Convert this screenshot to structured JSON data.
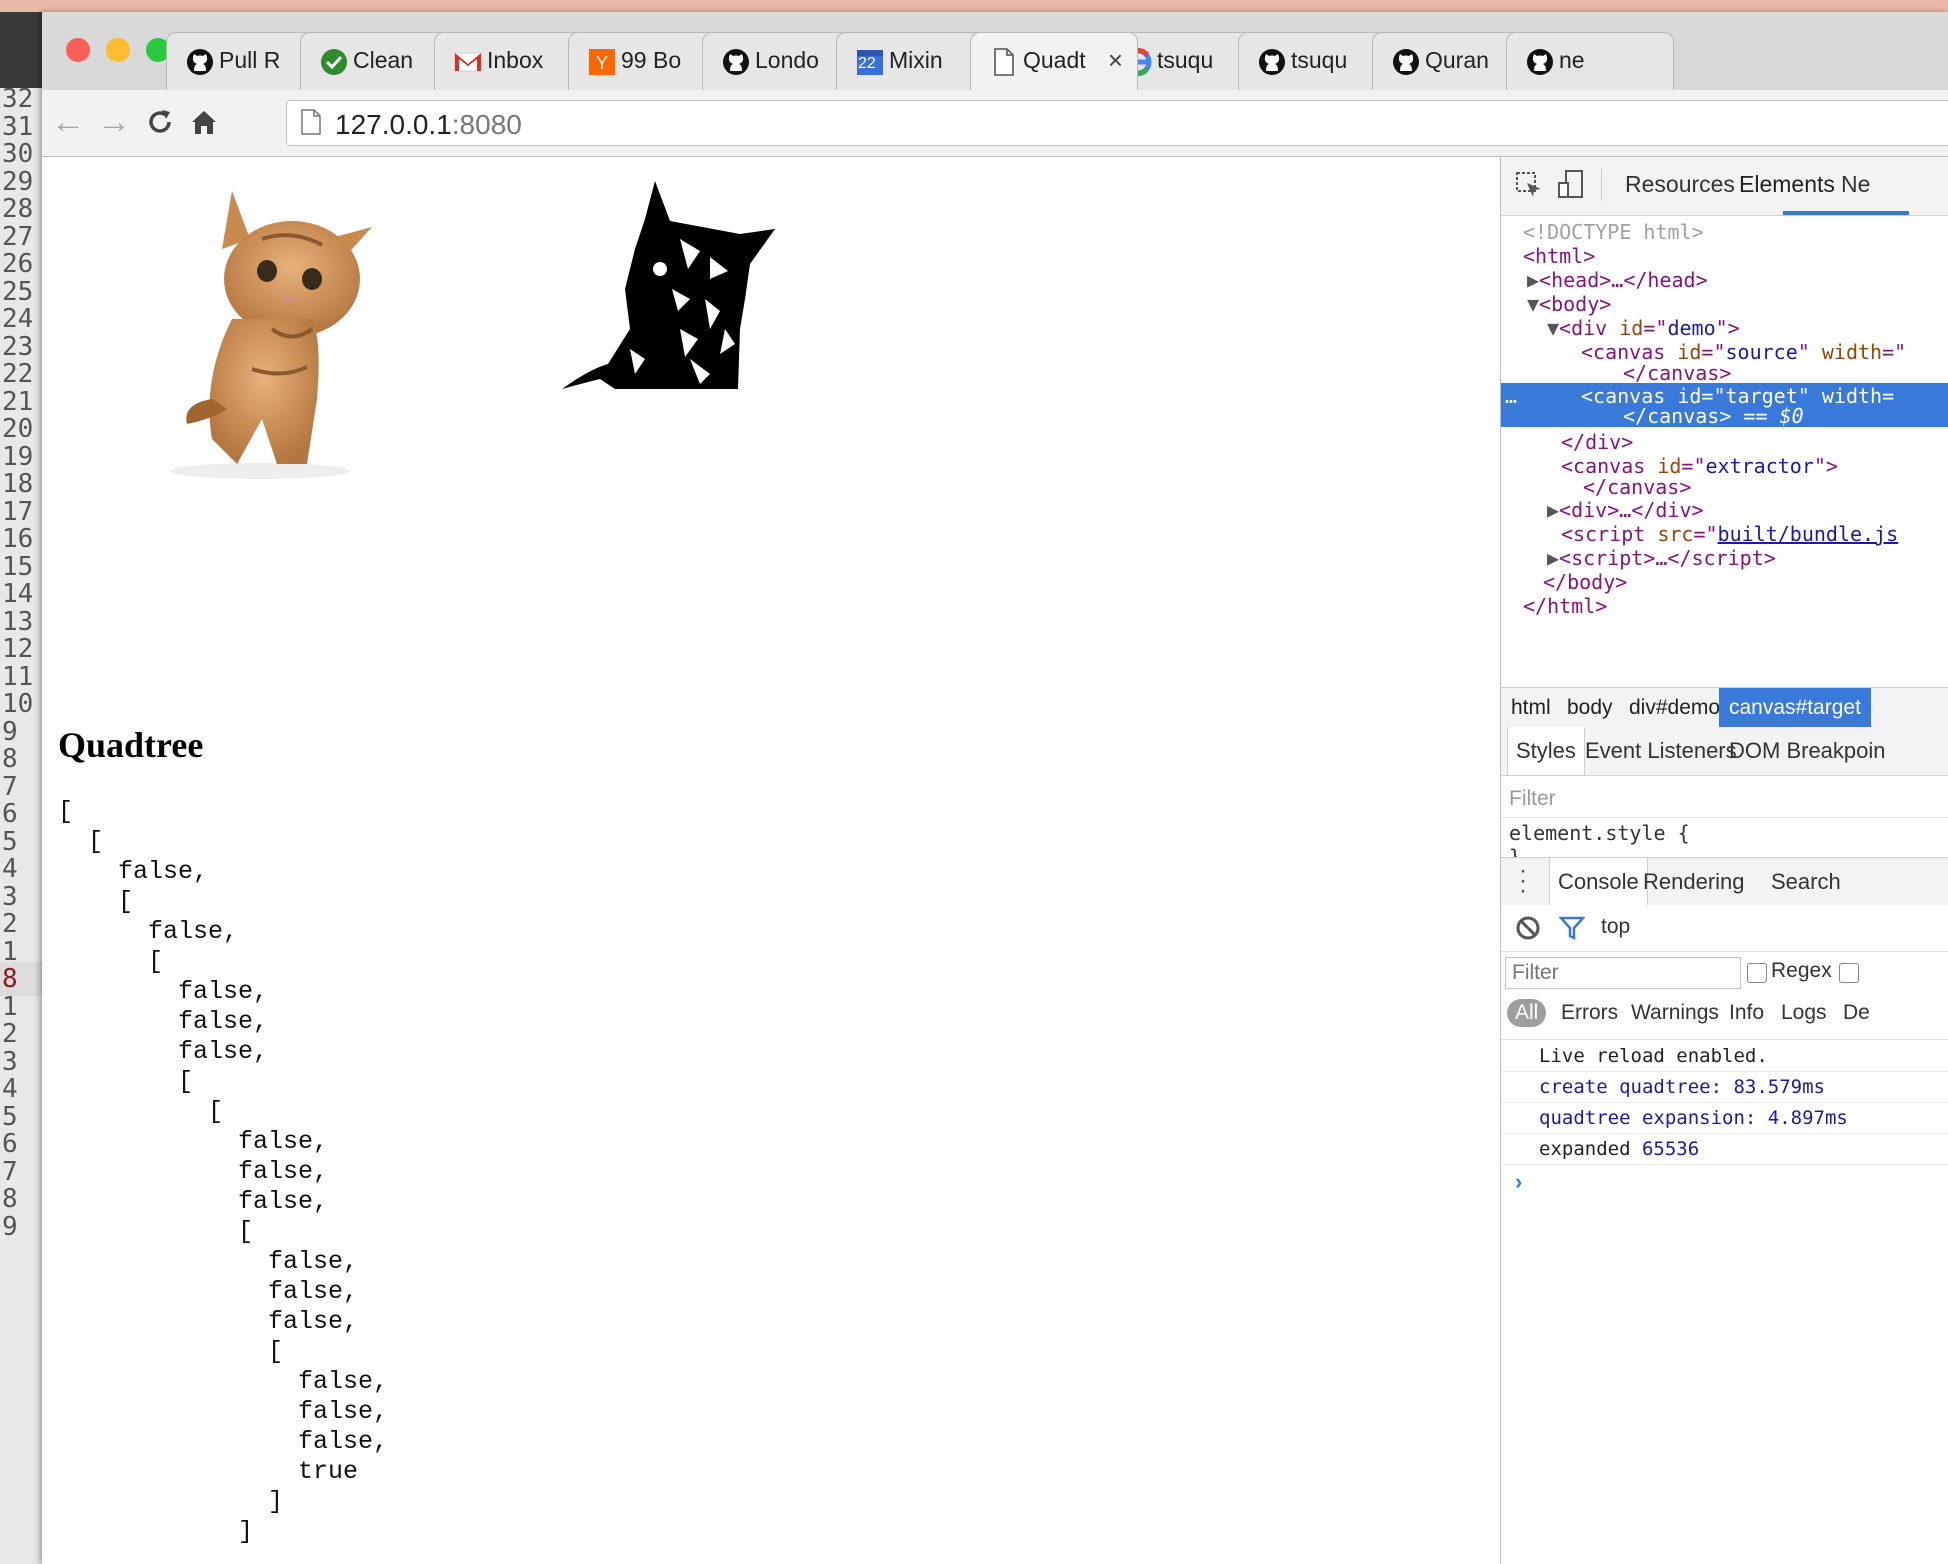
{
  "gutter_lines": [
    "32",
    "31",
    "30",
    "29",
    "28",
    "27",
    "26",
    "25",
    "24",
    "23",
    "22",
    "21",
    "20",
    "19",
    "18",
    "17",
    "16",
    "15",
    "14",
    "13",
    "12",
    "11",
    "10",
    "9",
    "8",
    "7",
    "6",
    "5",
    "4",
    "3",
    "2",
    "1",
    "8",
    "1",
    "2",
    "3",
    "4",
    "5",
    "6",
    "7",
    "8",
    "9"
  ],
  "tabs": [
    {
      "label": "Pull R",
      "icon": "github-icon"
    },
    {
      "label": "Clean",
      "icon": "check-circle-icon"
    },
    {
      "label": "Inbox",
      "icon": "gmail-icon"
    },
    {
      "label": "99 Bo",
      "icon": "ycombinator-icon"
    },
    {
      "label": "Londo",
      "icon": "github-icon"
    },
    {
      "label": "Mixin",
      "icon": "calendar-icon",
      "badge": "22"
    },
    {
      "label": "Quadt",
      "icon": "page-icon"
    },
    {
      "label": "tsuqu",
      "icon": "google-icon"
    },
    {
      "label": "tsuqu",
      "icon": "github-icon"
    },
    {
      "label": "Quran",
      "icon": "github-icon"
    },
    {
      "label": "ne",
      "icon": "github-icon"
    }
  ],
  "tab_close": "×",
  "address": {
    "host": "127.0.0.1",
    "port": ":8080"
  },
  "page": {
    "heading": "Quadtree",
    "output": "[\n  [\n    false,\n    [\n      false,\n      [\n        false,\n        false,\n        false,\n        [\n          [\n            false,\n            false,\n            false,\n            [\n              false,\n              false,\n              false,\n              [\n                false,\n                false,\n                false,\n                true\n              ]\n            ]"
  },
  "devtools": {
    "tabs": [
      "Resources",
      "Elements",
      "Ne"
    ],
    "active_tab": "Elements",
    "breadcrumbs": [
      "html",
      "body",
      "div#demo",
      "canvas#target"
    ],
    "subtabs": [
      "Styles",
      "Event Listeners",
      "DOM Breakpoin"
    ],
    "styles_filter": "Filter",
    "styles_rule_open": "element.style {",
    "styles_rule_close": "}",
    "drawer_tabs": [
      "Console",
      "Rendering",
      "Search"
    ],
    "context": "top",
    "console_filter_placeholder": "Filter",
    "regex_label": "Regex",
    "levels": [
      "All",
      "Errors",
      "Warnings",
      "Info",
      "Logs",
      "De"
    ],
    "messages": [
      {
        "text": "Live reload enabled.",
        "style": "log"
      },
      {
        "text": "create quadtree: 83.579ms",
        "style": "blue"
      },
      {
        "text": "quadtree expansion: 4.897ms",
        "style": "blue"
      },
      {
        "text": "expanded",
        "value": "65536",
        "style": "log"
      }
    ],
    "prompt": "›",
    "selected_marker": "== $0",
    "ellipsis": "…"
  }
}
